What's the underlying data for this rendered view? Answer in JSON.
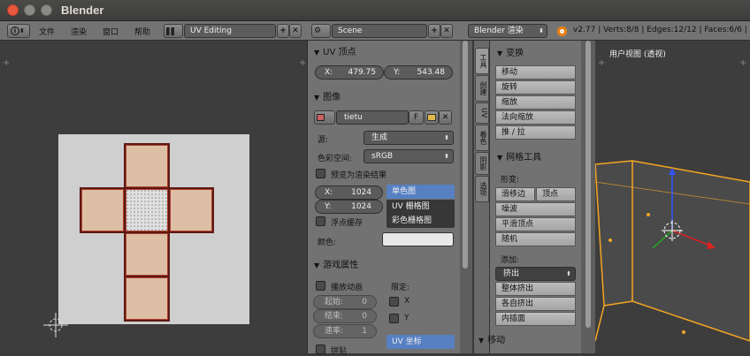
{
  "window": {
    "title": "Blender"
  },
  "header": {
    "info_icon": "i",
    "menus": [
      "文件",
      "渲染",
      "窗口",
      "帮助"
    ],
    "screen_layout": "UV Editing",
    "scene": "Scene",
    "render_engine": "Blender 渲染",
    "stats": "v2.77 | Verts:8/8 | Edges:12/12 | Faces:6/6 |"
  },
  "uv_panel": {
    "uv_vertex": {
      "title": "UV 顶点",
      "x_label": "X:",
      "x_value": "479.75",
      "y_label": "Y:",
      "y_value": "543.48"
    },
    "image": {
      "title": "图像",
      "name": "tietu",
      "fake_user": "F",
      "source_label": "源:",
      "source_value": "生成",
      "colorspace_label": "色彩空间:",
      "colorspace_value": "sRGB",
      "preview_render": "预览为渲染结果",
      "width_label": "X:",
      "width_value": "1024",
      "height_label": "Y:",
      "height_value": "1024",
      "float_buffer": "浮点缓存",
      "color_label": "颜色:",
      "type_options": [
        "单色图",
        "UV 栅格图",
        "彩色栅格图"
      ],
      "type_selected": "单色图"
    },
    "game": {
      "title": "游戏属性",
      "animated": "播放动画",
      "start_label": "起始:",
      "start_value": "0",
      "end_label": "结束:",
      "end_value": "0",
      "speed_label": "速率:",
      "speed_value": "1",
      "tiles": "拼贴",
      "clamp_label": "限定:",
      "clamp_x": "X",
      "clamp_y": "Y",
      "mapping": "UV 坐标"
    }
  },
  "tool_tabs": [
    "工具",
    "创建",
    "UV",
    "着色",
    "阴影",
    "选项",
    "插件"
  ],
  "tools": {
    "transform": {
      "title": "变换",
      "buttons": [
        "移动",
        "旋转",
        "缩放",
        "法向缩放",
        "推 / 拉"
      ]
    },
    "mesh_tools": {
      "title": "网格工具",
      "deform_label": "形变:",
      "slide_edge": "滑移边",
      "slide_vertex": "顶点",
      "deform_buttons": [
        "噪波",
        "平滑顶点",
        "随机"
      ],
      "add_label": "添加:",
      "extrude": "挤出",
      "add_buttons": [
        "整体挤出",
        "各自挤出",
        "内插面"
      ]
    },
    "move": {
      "title": "移动"
    }
  },
  "viewport": {
    "label": "用户视图 (透视)"
  },
  "colors": {
    "accent": "#5680c2",
    "uv_edge": "#5c1a14",
    "mesh_selected": "#f5a623"
  }
}
